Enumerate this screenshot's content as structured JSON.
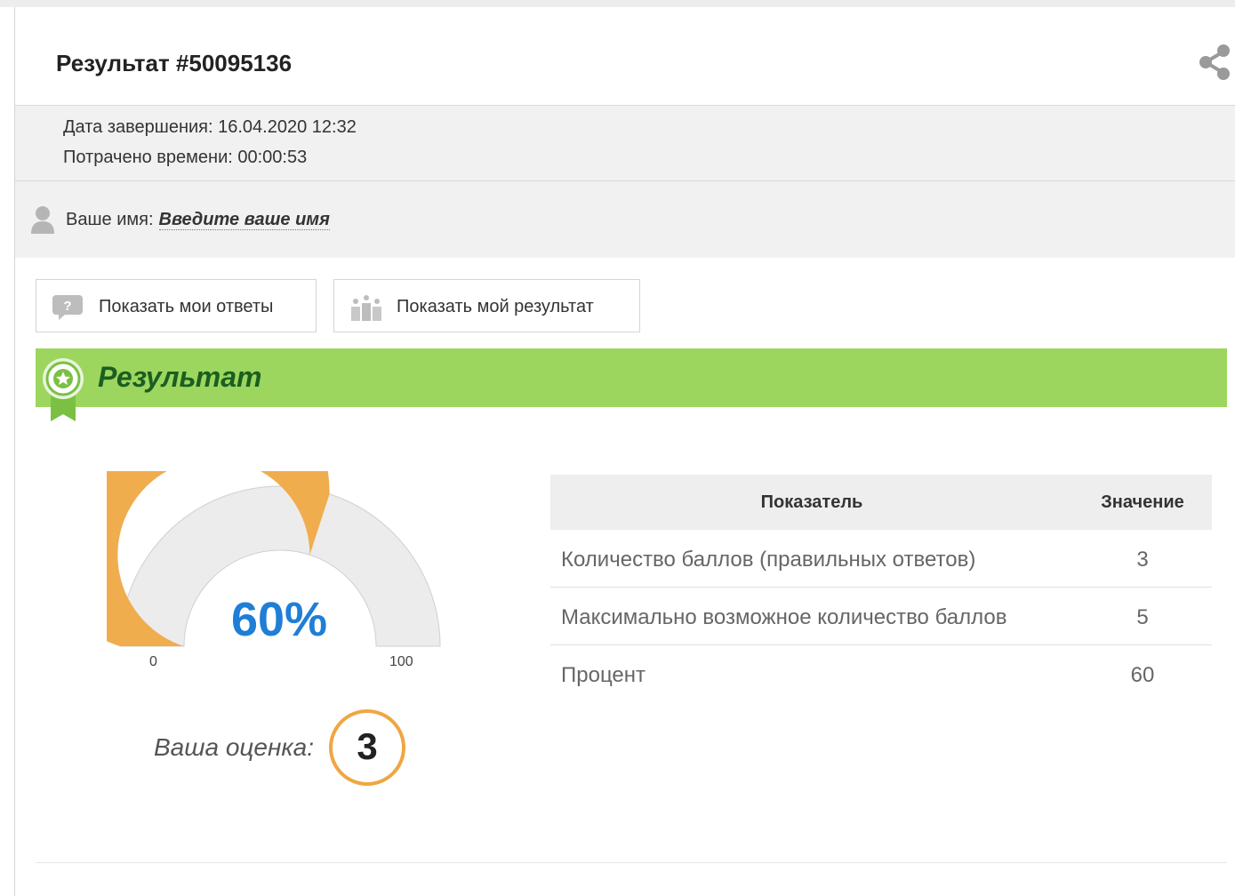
{
  "header": {
    "title": "Результат #50095136"
  },
  "meta": {
    "completion_label": "Дата завершения:",
    "completion_value": "16.04.2020 12:32",
    "time_label": "Потрачено времени:",
    "time_value": "00:00:53"
  },
  "name": {
    "label": "Ваше имя:",
    "value": "Введите ваше имя"
  },
  "buttons": {
    "show_answers": "Показать мои ответы",
    "show_result": "Показать мой результат"
  },
  "result": {
    "title": "Результат",
    "gauge": {
      "percent_label": "60%",
      "value": 60,
      "min": "0",
      "max": "100",
      "fill_color": "#f0ad4e",
      "track_color": "#ececec"
    },
    "grade_label": "Ваша оценка:",
    "grade_value": "3"
  },
  "table": {
    "headers": [
      "Показатель",
      "Значение"
    ],
    "rows": [
      {
        "name": "Количество баллов (правильных ответов)",
        "value": "3"
      },
      {
        "name": "Максимально возможное количество баллов",
        "value": "5"
      },
      {
        "name": "Процент",
        "value": "60"
      }
    ]
  },
  "colors": {
    "accent_green": "#9cd65e",
    "title_green": "#1b5e20",
    "percent_blue": "#1f7ed6",
    "grade_orange": "#f0a640"
  }
}
